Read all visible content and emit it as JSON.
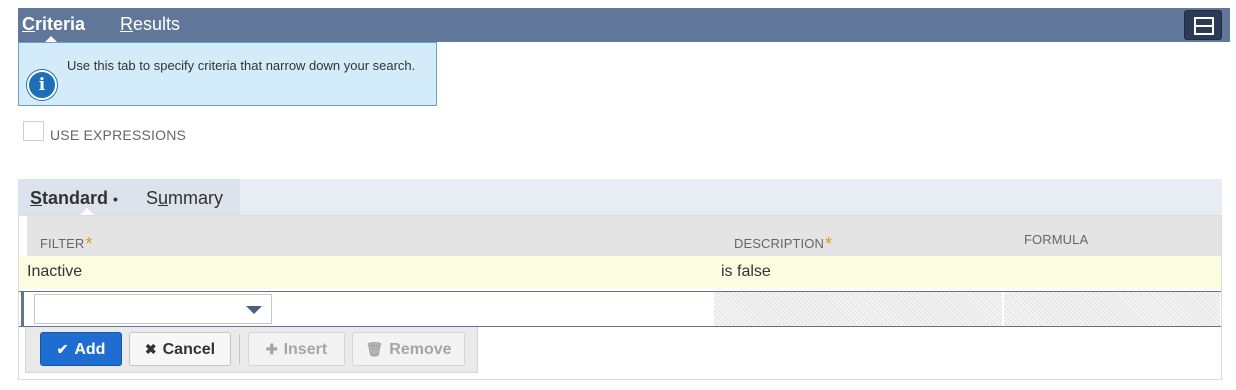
{
  "top_tabs": {
    "criteria": {
      "first": "C",
      "rest": "riteria"
    },
    "results": {
      "first": "R",
      "rest": "esults"
    }
  },
  "info": {
    "icon": "info-icon",
    "text": "Use this tab to specify criteria that narrow down your search."
  },
  "use_expressions": {
    "label": "USE EXPRESSIONS",
    "checked": false
  },
  "sub_tabs": {
    "standard": {
      "first": "S",
      "rest": "tandard",
      "marker": "•"
    },
    "summary": {
      "before": "S",
      "u": "u",
      "after": "mmary"
    }
  },
  "table": {
    "headers": {
      "filter": "FILTER",
      "description": "DESCRIPTION",
      "formula": "FORMULA",
      "required_mark": "*"
    },
    "rows": [
      {
        "filter": "Inactive",
        "description": "is false",
        "formula": ""
      }
    ],
    "new_row": {
      "filter_value": ""
    }
  },
  "buttons": {
    "add": "Add",
    "cancel": "Cancel",
    "insert": "Insert",
    "remove": "Remove"
  },
  "colors": {
    "topbar": "#607799",
    "info_bg": "#d4ecf9",
    "add_button": "#1f6dd1",
    "required": "#e39a1b"
  }
}
